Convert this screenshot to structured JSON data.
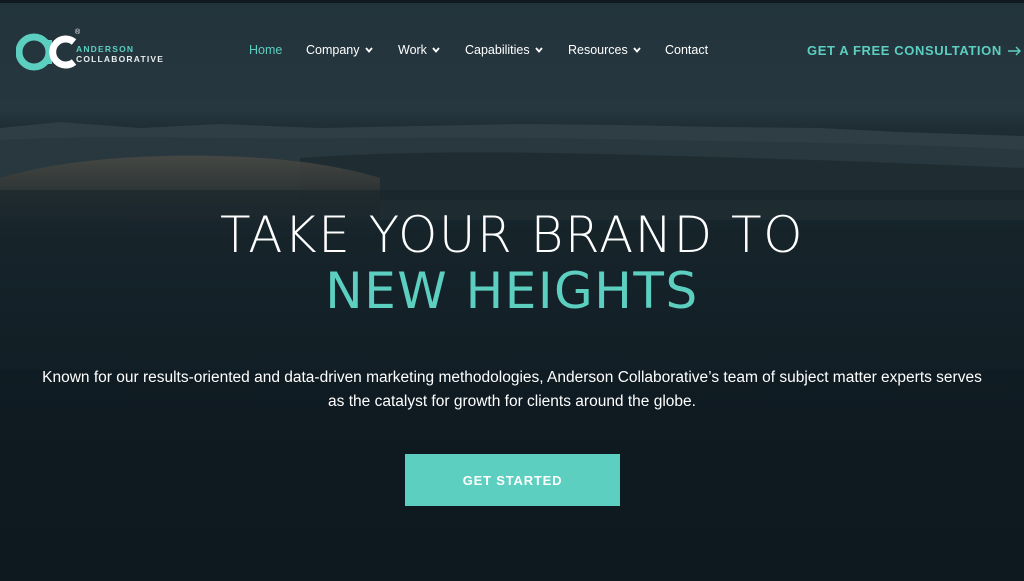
{
  "brand": {
    "name_line1": "ANDERSON",
    "name_line2": "COLLABORATIVE",
    "registered": "®",
    "accent_color": "#5ccfc1"
  },
  "nav": {
    "items": [
      {
        "label": "Home",
        "active": true,
        "dropdown": false
      },
      {
        "label": "Company",
        "active": false,
        "dropdown": true
      },
      {
        "label": "Work",
        "active": false,
        "dropdown": true
      },
      {
        "label": "Capabilities",
        "active": false,
        "dropdown": true
      },
      {
        "label": "Resources",
        "active": false,
        "dropdown": true
      },
      {
        "label": "Contact",
        "active": false,
        "dropdown": false
      }
    ],
    "cta_label": "GET A FREE CONSULTATION",
    "cta_icon": "arrow-right-icon"
  },
  "hero": {
    "headline_line1": "TAKE YOUR BRAND TO",
    "headline_line2": "NEW HEIGHTS",
    "description": "Known for our results-oriented and data-driven marketing methodologies, Anderson Collaborative’s team of subject matter experts serves as the catalyst for growth for clients around the globe.",
    "button_label": "GET STARTED"
  }
}
